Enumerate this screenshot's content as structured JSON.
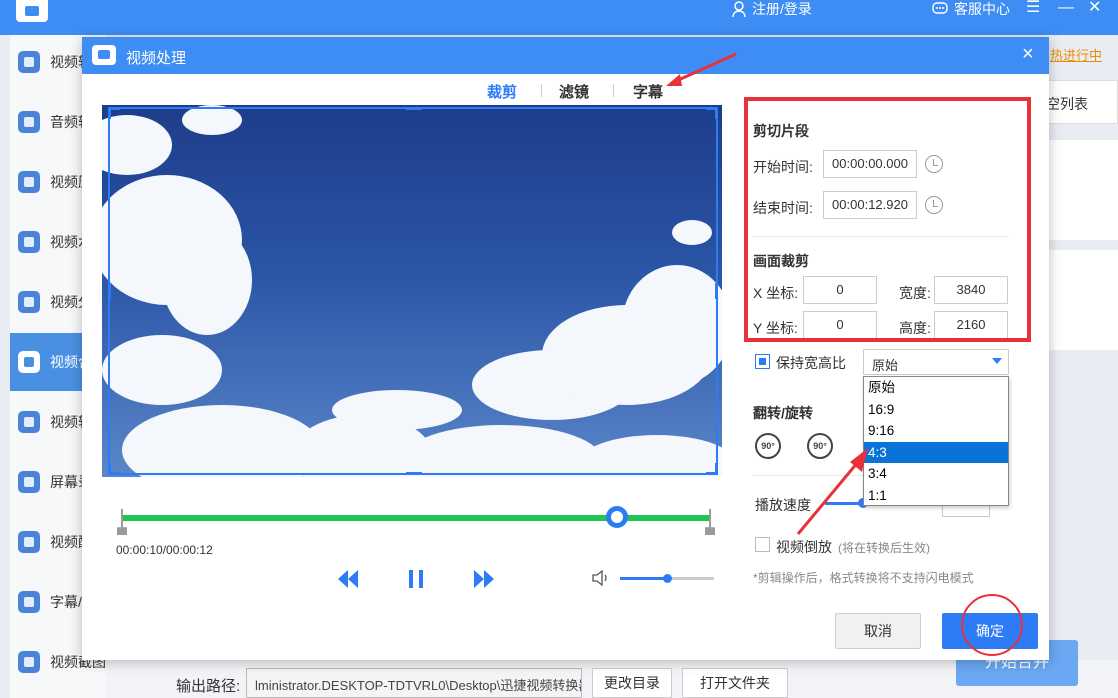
{
  "app": {
    "register_login": "注册/登录",
    "customer_service": "客服中心",
    "sidebar": [
      {
        "label": "视频转"
      },
      {
        "label": "音频转"
      },
      {
        "label": "视频压"
      },
      {
        "label": "视频水"
      },
      {
        "label": "视频分"
      },
      {
        "label": "视频合"
      },
      {
        "label": "视频转"
      },
      {
        "label": "屏幕录"
      },
      {
        "label": "视频配"
      },
      {
        "label": "字幕/"
      },
      {
        "label": "视频截图"
      }
    ],
    "right_link": "热进行中",
    "right_clear": "空列表",
    "output_label": "输出路径:",
    "output_path": "lministrator.DESKTOP-TDTVRL0\\Desktop\\迅捷视频转换器",
    "change_dir": "更改目录",
    "open_folder": "打开文件夹",
    "start_merge": "开始合并"
  },
  "dialog": {
    "title": "视频处理",
    "close": "×",
    "tabs": [
      {
        "label": "裁剪",
        "active": true
      },
      {
        "label": "滤镜",
        "active": false
      },
      {
        "label": "字幕",
        "active": false
      }
    ],
    "player": {
      "time": "00:00:10/00:00:12",
      "progress": 0.83,
      "volume": 0.5
    },
    "clip": {
      "title": "剪切片段",
      "start_label": "开始时间:",
      "start_value": "00:00:00.000",
      "end_label": "结束时间:",
      "end_value": "00:00:12.920"
    },
    "crop": {
      "title": "画面裁剪",
      "x_label": "X 坐标:",
      "x_value": "0",
      "y_label": "Y 坐标:",
      "y_value": "0",
      "width_label": "宽度:",
      "width_value": "3840",
      "height_label": "高度:",
      "height_value": "2160"
    },
    "aspect": {
      "checkbox_label": "保持宽高比",
      "selected": "原始",
      "options": [
        "原始",
        "16:9",
        "9:16",
        "4:3",
        "3:4",
        "1:1"
      ],
      "highlighted": "4:3"
    },
    "flip": {
      "title": "翻转/旋转",
      "rotate_left": "90°",
      "rotate_right": "90°"
    },
    "speed": {
      "label": "播放速度"
    },
    "reverse": {
      "label": "视频倒放",
      "note": "(将在转换后生效)"
    },
    "footnote": "*剪辑操作后，格式转换将不支持闪电模式",
    "cancel": "取消",
    "ok": "确定"
  },
  "colors": {
    "brand_blue": "#3d8df5",
    "accent_blue": "#2d7cf6",
    "timeline_green": "#1fc454",
    "annotation_red": "#e8323a",
    "link_orange": "#f08c00"
  }
}
